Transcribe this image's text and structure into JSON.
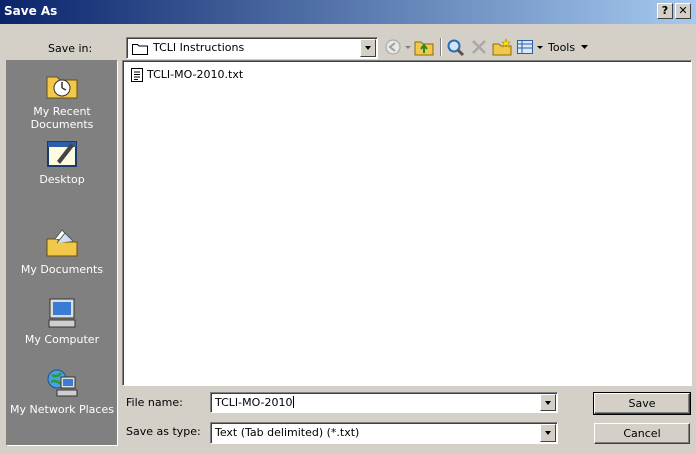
{
  "window": {
    "title": "Save As",
    "help_glyph": "?",
    "close_glyph": "✕"
  },
  "toolbar": {
    "save_in_label": "Save in:",
    "location": "TCLI Instructions",
    "tools_label": "Tools"
  },
  "places": [
    {
      "label": "My Recent Documents",
      "icon": "recent-documents-icon"
    },
    {
      "label": "Desktop",
      "icon": "desktop-icon"
    },
    {
      "label": "My Documents",
      "icon": "my-documents-icon"
    },
    {
      "label": "My Computer",
      "icon": "my-computer-icon"
    },
    {
      "label": "My Network Places",
      "icon": "network-places-icon"
    }
  ],
  "files": [
    {
      "name": "TCLI-MO-2010.txt",
      "icon": "text-file-icon"
    }
  ],
  "form": {
    "file_name_label": "File name:",
    "file_name_value": "TCLI-MO-2010",
    "save_type_label": "Save as type:",
    "save_type_value": "Text (Tab delimited) (*.txt)"
  },
  "buttons": {
    "save": "Save",
    "cancel": "Cancel"
  }
}
